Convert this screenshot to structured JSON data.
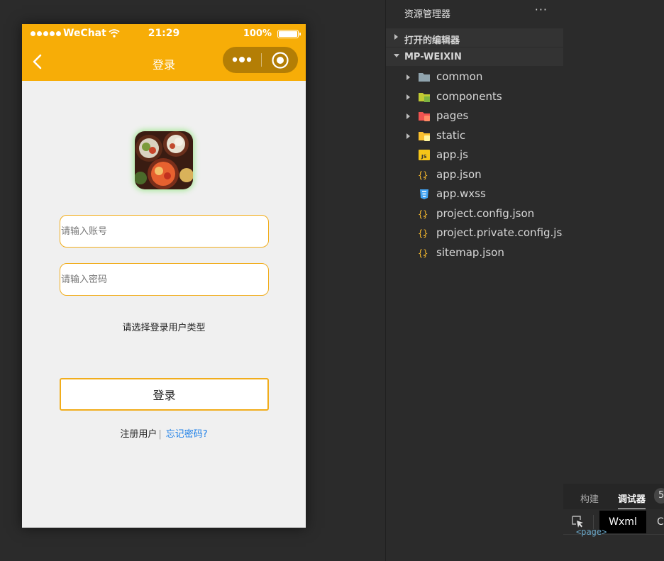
{
  "simulator": {
    "status_bar": {
      "carrier": "WeChat",
      "time": "21:29",
      "battery": "100%",
      "battery_level": 1.0
    },
    "nav_bar": {
      "title": "登录"
    },
    "form": {
      "account_placeholder": "请输入账号",
      "password_placeholder": "请输入密码",
      "user_type_prompt": "请选择登录用户类型",
      "login_label": "登录"
    },
    "links": {
      "register": "注册用户",
      "divider": "|",
      "forgot": "忘记密码?"
    }
  },
  "explorer": {
    "header": "资源管理器",
    "more": "···",
    "sections": [
      {
        "label": "打开的编辑器",
        "expanded": false
      },
      {
        "label": "MP-WEIXIN",
        "expanded": true
      }
    ],
    "items": [
      {
        "name": "common",
        "icon": "folder-icon",
        "expandable": true
      },
      {
        "name": "components",
        "icon": "components-folder-icon",
        "expandable": true
      },
      {
        "name": "pages",
        "icon": "pages-folder-icon",
        "expandable": true
      },
      {
        "name": "static",
        "icon": "static-folder-icon",
        "expandable": true
      },
      {
        "name": "app.js",
        "icon": "js-file-icon",
        "expandable": false
      },
      {
        "name": "app.json",
        "icon": "json-file-icon",
        "expandable": false
      },
      {
        "name": "app.wxss",
        "icon": "css-file-icon",
        "expandable": false
      },
      {
        "name": "project.config.json",
        "icon": "json-file-icon",
        "expandable": false
      },
      {
        "name": "project.private.config.js...",
        "icon": "json-file-icon",
        "expandable": false
      },
      {
        "name": "sitemap.json",
        "icon": "json-file-icon",
        "expandable": false
      }
    ]
  },
  "debug_panel": {
    "tabs": [
      "构建",
      "调试器"
    ],
    "badge": "5",
    "subtabs": [
      "Wxml",
      "C"
    ],
    "code": "<page>"
  },
  "colors": {
    "brand": "#f7ad07",
    "input_border": "#f1ad1c",
    "link": "#1a7ee8"
  }
}
